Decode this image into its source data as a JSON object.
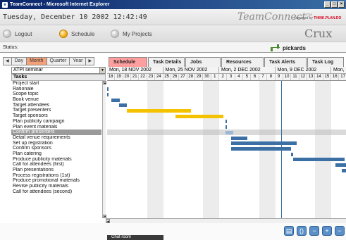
{
  "window": {
    "title": "TeamConnect - Microsoft Internet Explorer",
    "buttons": [
      "_",
      "□",
      "×"
    ]
  },
  "header": {
    "datetime": "Tuesday, December 10 2002  12:42:49",
    "brand": "TeamConnect",
    "brand_tm": "TM",
    "powered_prefix": "powered by",
    "powered_brand": "THINK.PLAN.DO"
  },
  "nav": {
    "logout": "Logout",
    "schedule": "Schedule",
    "my_projects": "My Projects",
    "logo": "Crux"
  },
  "status": {
    "label": "Status:",
    "user": "pickards"
  },
  "view_tabs": [
    "Day",
    "Month",
    "Quarter",
    "Year"
  ],
  "view_tabs_active": "Month",
  "main_tabs": [
    "Schedule",
    "Task Details",
    "Jobs",
    "Resources",
    "Task Alerts",
    "Task Log"
  ],
  "main_tabs_active": "Schedule",
  "project": {
    "selected": "ATPI seminar"
  },
  "tasks_header": "Tasks",
  "tasks": [
    "Project start",
    "Rationale",
    "Scope topic",
    "Book venue",
    "Target attendees",
    "Target presenters",
    "Target sponsors",
    "Plan publicity campaign",
    "Plan event materials",
    "Confirm presenters",
    "Detail venue requirements",
    "Set up registration",
    "Confirm sponsors",
    "Plan catering",
    "Produce publicity materials",
    "Call for attendees (first)",
    "Plan presentations",
    "Process registrations (1st)",
    "Produce promotional materials",
    "Revise publicity materials",
    "Call for attendees (second)"
  ],
  "selected_task": "Confirm presenters",
  "weeks": [
    "Mon, 18 NOV 2002",
    "Mon, 25 NOV 2002",
    "Mon, 2 DEC 2002",
    "Mon, 9 DEC 2002",
    "Mon,"
  ],
  "days": [
    "18",
    "19",
    "20",
    "21",
    "22",
    "23",
    "24",
    "25",
    "26",
    "27",
    "28",
    "29",
    "30",
    "1",
    "2",
    "3",
    "4",
    "5",
    "6",
    "7",
    "8",
    "9",
    "10",
    "11",
    "12",
    "13",
    "14",
    "15",
    "16",
    "17"
  ],
  "footer": {
    "chat": "Chat room"
  },
  "tool_icons": [
    "document-icon",
    "brackets-icon",
    "minus-icon",
    "plus-icon",
    "close-icon"
  ],
  "colors": {
    "task_bar": "#3c6fa4",
    "milestone_bar": "#f5c200",
    "active_tab": "#ff9e9e",
    "active_view": "#f4a078"
  }
}
